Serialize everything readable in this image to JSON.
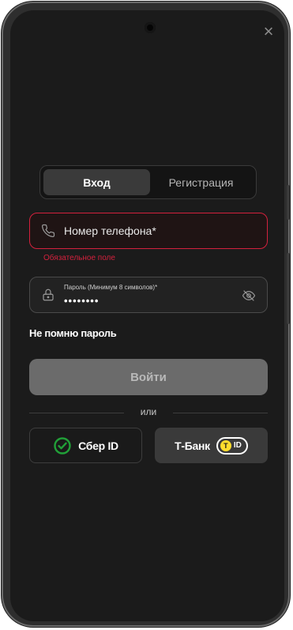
{
  "close_icon": "×",
  "tabs": {
    "login": "Вход",
    "register": "Регистрация"
  },
  "phone": {
    "placeholder": "Номер телефона*",
    "error": "Обязательное поле"
  },
  "password": {
    "label": "Пароль (Минимум 8 символов)*",
    "value": "••••••••"
  },
  "forgot": "Не помню пароль",
  "login_button": "Войти",
  "divider": "или",
  "sber": {
    "label": "Сбер ID",
    "icon": "sber-check-icon",
    "color": "#21a038"
  },
  "tbank": {
    "label": "Т-Банк",
    "badge": "ID",
    "badge_letter": "Т",
    "color": "#ffdd2d"
  },
  "accent_error": "#d4213d"
}
